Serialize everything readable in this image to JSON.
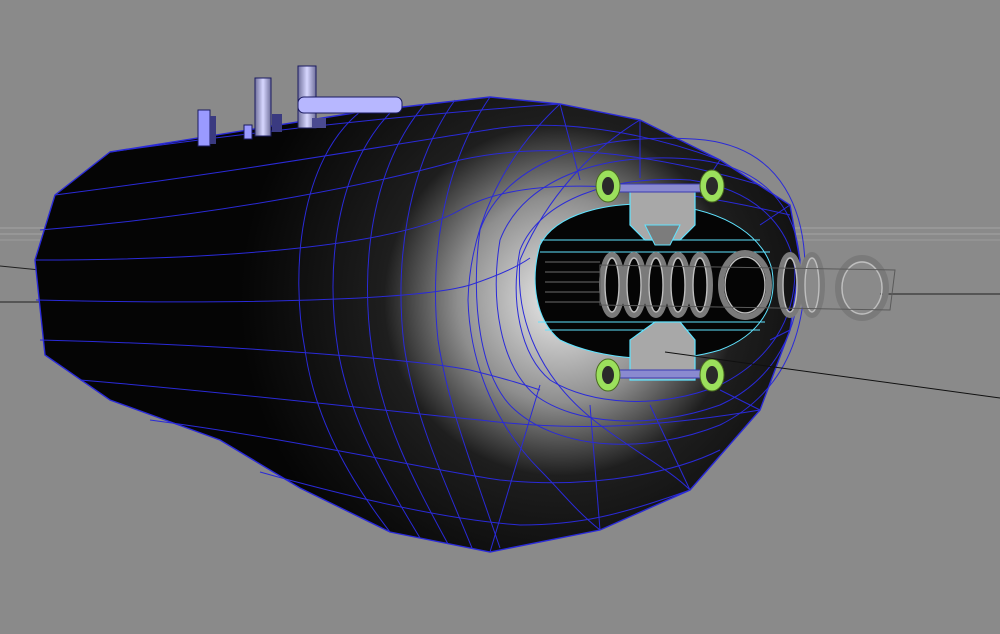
{
  "viewport": {
    "label": "",
    "background": "#8a8a8a"
  },
  "colors": {
    "wireframe": "#2a2ad8",
    "selection": "#5fe3ff",
    "pivot_green": "#9be05c",
    "hull_dark": "#050505",
    "hull_light": "#e2e2e2",
    "parts": "#9a9aff"
  },
  "objects": [
    {
      "name": "hull"
    },
    {
      "name": "intake-opening"
    },
    {
      "name": "coil-array"
    },
    {
      "name": "top-bracket"
    },
    {
      "name": "bottom-bracket"
    },
    {
      "name": "top-pipes"
    },
    {
      "name": "manipulator-line"
    }
  ]
}
